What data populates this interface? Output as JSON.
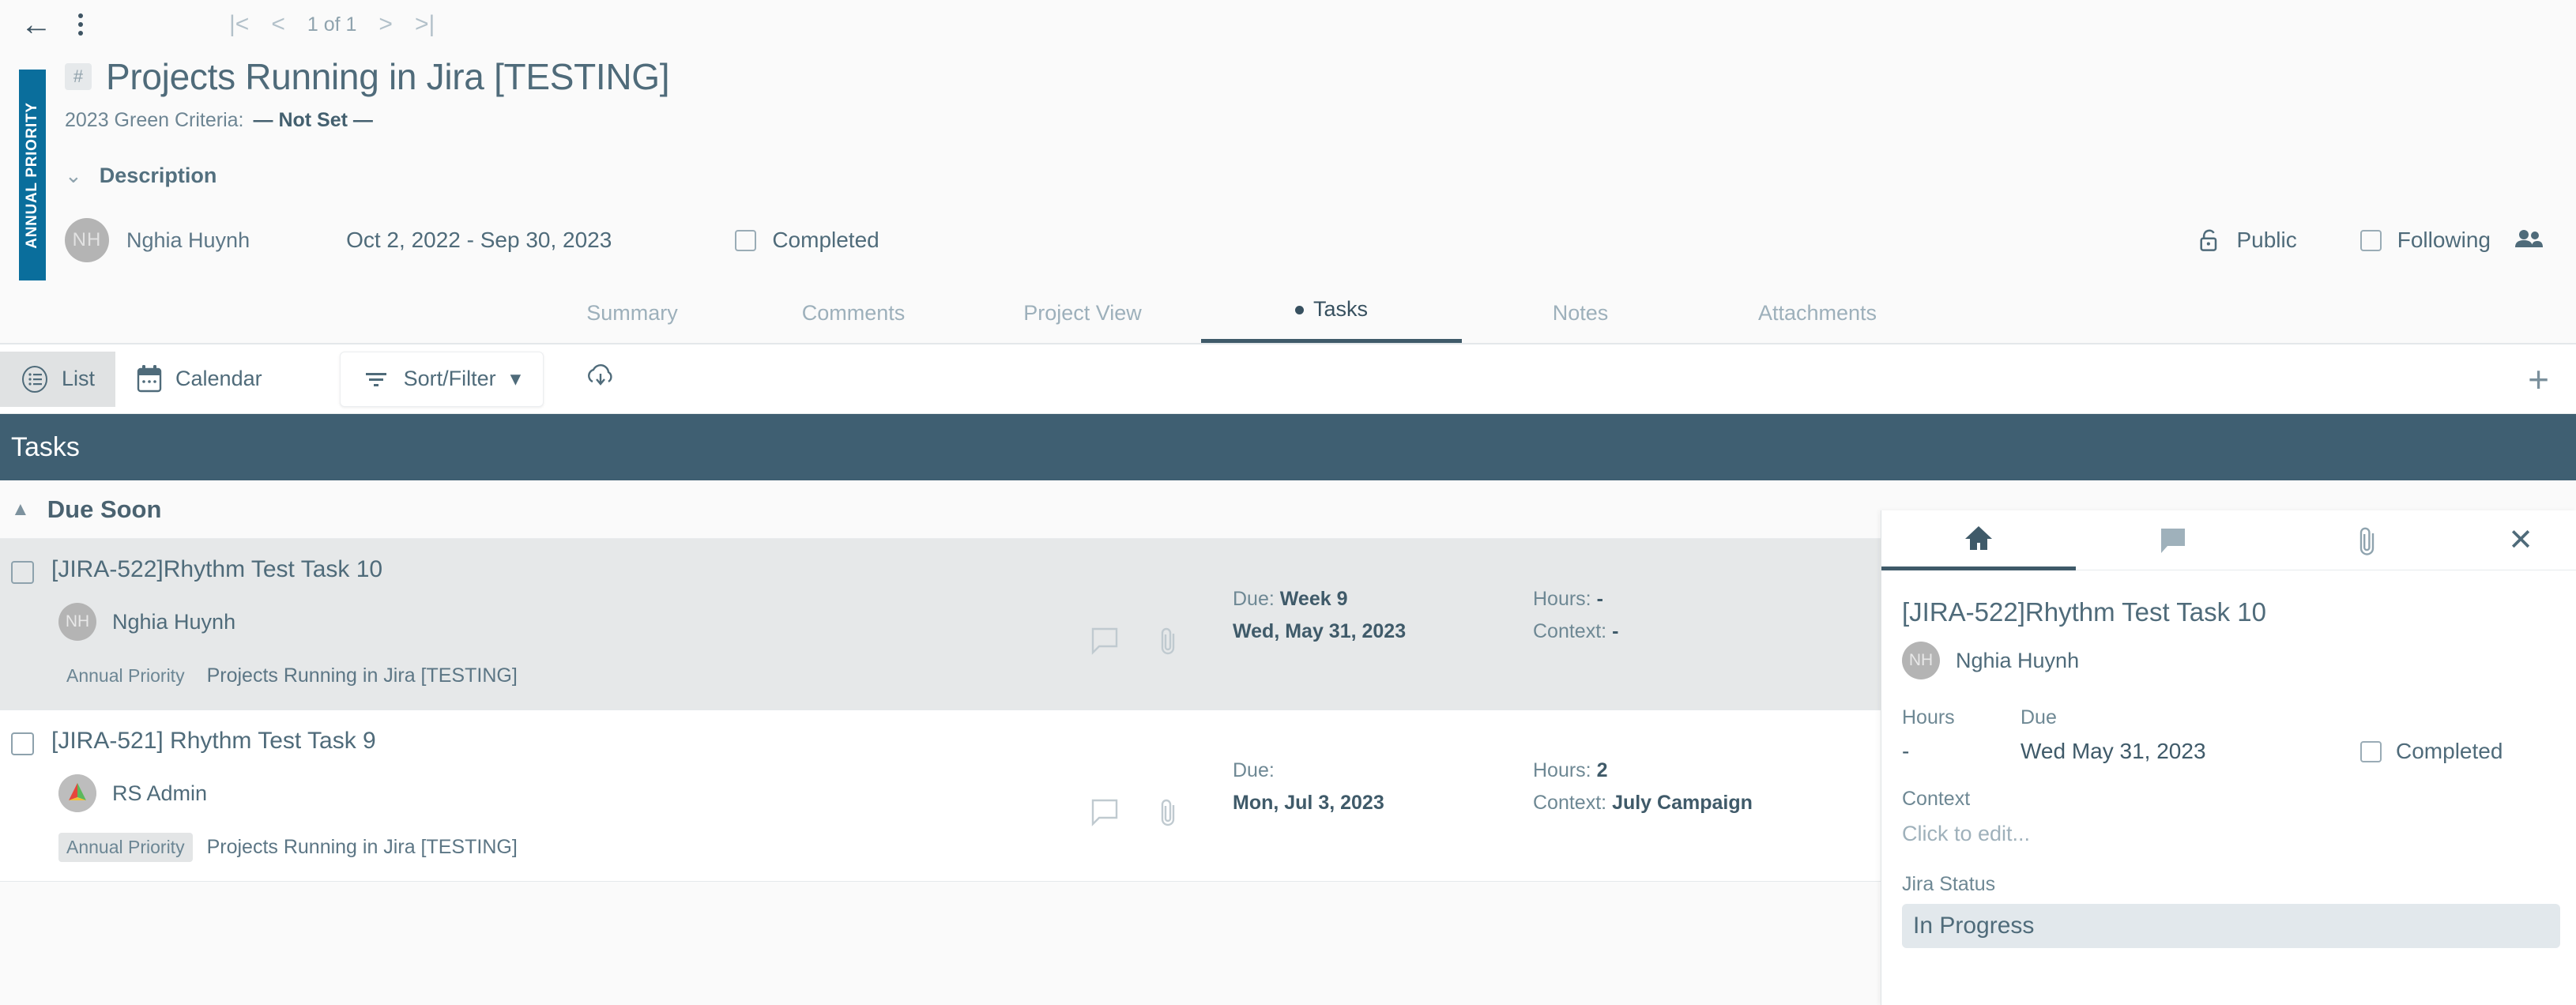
{
  "topbar": {
    "back_icon": "back-arrow-icon",
    "menu_icon": "kebab-menu-icon",
    "first_icon": "first-page-icon",
    "prev_icon": "prev-page-icon",
    "page_text": "1 of 1",
    "next_icon": "next-page-icon",
    "last_icon": "last-page-icon"
  },
  "strip": {
    "label": "ANNUAL PRIORITY",
    "color": "#0a6e9c"
  },
  "header": {
    "hash": "#",
    "title": "Projects Running in Jira [TESTING]",
    "criteria_label": "2023 Green Criteria:",
    "criteria_value": "— Not Set —",
    "description_label": "Description"
  },
  "meta": {
    "avatar_initials": "NH",
    "owner": "Nghia Huynh",
    "dates": "Oct 2, 2022 - Sep 30, 2023",
    "completed_label": "Completed",
    "public_label": "Public",
    "following_label": "Following",
    "lock_icon": "unlock-icon",
    "people_icon": "people-icon"
  },
  "tabs": [
    {
      "label": "Summary",
      "active": false
    },
    {
      "label": "Comments",
      "active": false
    },
    {
      "label": "Project View",
      "active": false
    },
    {
      "label": "Tasks",
      "active": true
    },
    {
      "label": "Notes",
      "active": false
    },
    {
      "label": "Attachments",
      "active": false
    }
  ],
  "toolbar": {
    "list_label": "List",
    "calendar_label": "Calendar",
    "sort_filter_label": "Sort/Filter",
    "download_icon": "download-cloud-icon",
    "add_icon": "plus-icon"
  },
  "tasks_header": "Tasks",
  "group": {
    "label": "Due Soon",
    "collapse_icon": "chevron-up-icon"
  },
  "rows": [
    {
      "title": "[JIRA-522]Rhythm Test Task 10",
      "avatar_initials": "NH",
      "avatar_type": "initials",
      "user": "Nghia Huynh",
      "tag": "Annual Priority",
      "project": "Projects Running in Jira [TESTING]",
      "due_label": "Due:",
      "due_week": "Week 9",
      "due_date": "Wed, May 31, 2023",
      "hours_label": "Hours:",
      "hours_value": "-",
      "context_label": "Context:",
      "context_value": "-",
      "selected": true
    },
    {
      "title": "[JIRA-521] Rhythm Test Task 9",
      "avatar_initials": "",
      "avatar_type": "logo",
      "user": "RS Admin",
      "tag": "Annual Priority",
      "project": "Projects Running in Jira [TESTING]",
      "due_label": "Due:",
      "due_week": "",
      "due_date": "Mon, Jul 3, 2023",
      "hours_label": "Hours:",
      "hours_value": "2",
      "context_label": "Context:",
      "context_value": "July Campaign",
      "selected": false
    }
  ],
  "panel": {
    "tabs": [
      {
        "icon": "home-icon",
        "active": true
      },
      {
        "icon": "comment-icon",
        "active": false
      },
      {
        "icon": "paperclip-icon",
        "active": false
      }
    ],
    "close_icon": "close-icon",
    "title": "[JIRA-522]Rhythm Test Task 10",
    "avatar_initials": "NH",
    "user": "Nghia Huynh",
    "hours_label": "Hours",
    "hours_value": "-",
    "due_label": "Due",
    "due_value": "Wed May 31, 2023",
    "completed_label": "Completed",
    "context_label": "Context",
    "context_placeholder": "Click to edit...",
    "jira_status_label": "Jira Status",
    "jira_status_value": "In Progress"
  }
}
